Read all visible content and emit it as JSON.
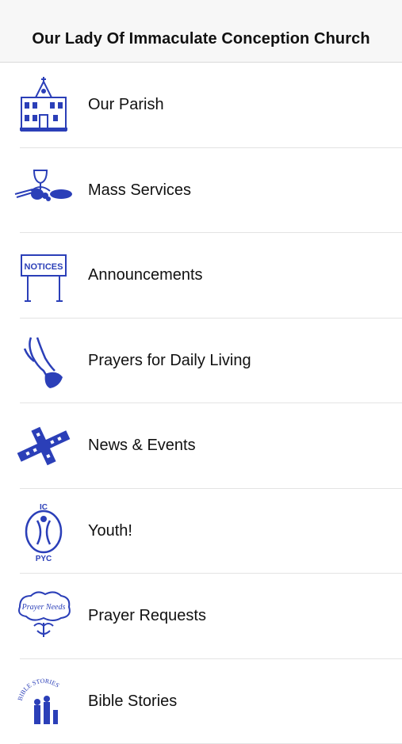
{
  "header": {
    "title": "Our Lady Of Immaculate Conception Church"
  },
  "menu": {
    "items": [
      {
        "label": "Our Parish",
        "icon": "church-icon"
      },
      {
        "label": "Mass Services",
        "icon": "chalice-icon"
      },
      {
        "label": "Announcements",
        "icon": "notices-sign-icon"
      },
      {
        "label": "Prayers for Daily Living",
        "icon": "praying-hands-icon"
      },
      {
        "label": "News & Events",
        "icon": "news-events-crossword-icon"
      },
      {
        "label": "Youth!",
        "icon": "youth-pyc-icon"
      },
      {
        "label": "Prayer Requests",
        "icon": "prayer-needs-icon",
        "icon_text": "Prayer Needs"
      },
      {
        "label": "Bible Stories",
        "icon": "bible-stories-icon",
        "icon_text": "BIBLE STORIES"
      }
    ]
  },
  "colors": {
    "icon_blue": "#2b3fb8",
    "navbar_bg": "#f7f7f7",
    "separator": "#e3e3e3"
  }
}
